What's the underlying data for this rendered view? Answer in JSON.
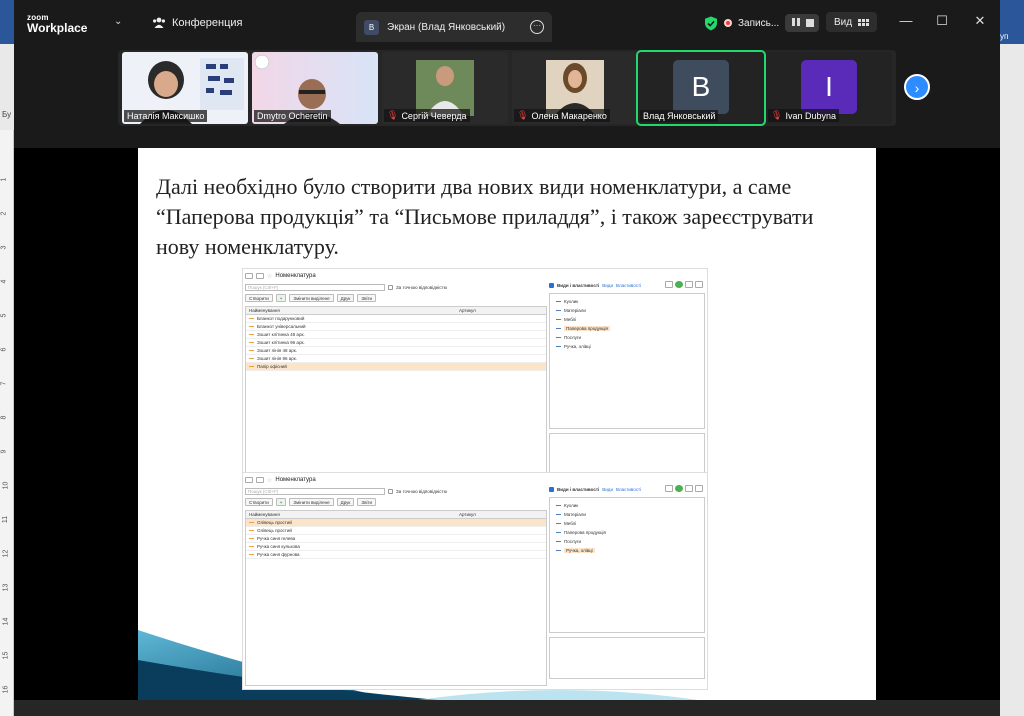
{
  "word": {
    "bu_label": "Бу",
    "right_tab": "уп",
    "ruler_numbers": [
      "1",
      "2",
      "3",
      "4",
      "5",
      "6",
      "7",
      "8",
      "9",
      "10",
      "11",
      "12",
      "13",
      "14",
      "15",
      "16"
    ]
  },
  "titlebar": {
    "logo_small": "zoom",
    "logo_big": "Workplace",
    "conference_label": "Конференция",
    "screen_tab_badge": "В",
    "screen_tab_label": "Экран (Влад Янковський)",
    "recording_label": "Запись...",
    "view_label": "Вид"
  },
  "participants": [
    {
      "name": "Наталія Максишко",
      "muted": false,
      "avatar": "",
      "video": true
    },
    {
      "name": "Dmytro Ocheretin",
      "muted": false,
      "avatar": "",
      "video": true
    },
    {
      "name": "Сергій Чеверда",
      "muted": true,
      "avatar": "",
      "video": true
    },
    {
      "name": "Олена Макаренко",
      "muted": true,
      "avatar": "",
      "video": true
    },
    {
      "name": "Влад Янковський",
      "muted": false,
      "avatar": "В",
      "video": false,
      "active": true,
      "color": "#3f4c5e"
    },
    {
      "name": "Ivan Dubyna",
      "muted": true,
      "avatar": "I",
      "video": false,
      "color": "#5a2bb8"
    }
  ],
  "slide": {
    "text": "Далі необхідно було створити два нових види номенклатури, а саме “Паперова продукція” та “Письмове приладдя”, і також зареєструвати нову номенклатуру."
  },
  "shot1": {
    "title": "Номенклатура",
    "search_placeholder": "Пошук (Ctrl+F)",
    "exact_label": "За точною відповідністю",
    "buttons": [
      "Створити",
      "Змінити видiлене",
      "Друк",
      "Звіти"
    ],
    "col_name": "Найменування",
    "col_article": "Артикул",
    "rows": [
      "Бланкот подарунковий",
      "Бланкот універсальний",
      "Зошит клітинка 48 арк.",
      "Зошит клітинка 96 арк.",
      "Зошит лінія 48 арк.",
      "Зошит лінія 96 арк.",
      "Папір офісний"
    ],
    "selected_row": 6,
    "panel_head": "Види і властивості",
    "panel_links": [
      "Види",
      "Властивості"
    ],
    "tree": [
      "Кухлик",
      "Матеріали",
      "Меблі",
      "Паперова продукція",
      "Послуги",
      "Ручка, олівці"
    ],
    "selected_tree": 3
  },
  "shot2": {
    "title": "Номенклатура",
    "search_placeholder": "Пошук (Ctrl+F)",
    "exact_label": "За точною відповідністю",
    "buttons": [
      "Створити",
      "Змінити видiлене",
      "Друк",
      "Звіти"
    ],
    "col_name": "Найменування",
    "col_article": "Артикул",
    "rows": [
      "Олівець простий",
      "Олівець простий",
      "Ручка синя гелева",
      "Ручка синя кулькова",
      "Ручка синя фурнова"
    ],
    "selected_row": 0,
    "panel_head": "Види і властивості",
    "panel_links": [
      "Види",
      "Властивості"
    ],
    "tree": [
      "Кухлик",
      "Матеріали",
      "Меблі",
      "Паперова продукція",
      "Послуги",
      "Ручка, олівці"
    ],
    "selected_tree": 5
  },
  "colors": {
    "accent": "#2d8cff",
    "active_tile": "#23d96b",
    "record": "#e8413e"
  }
}
